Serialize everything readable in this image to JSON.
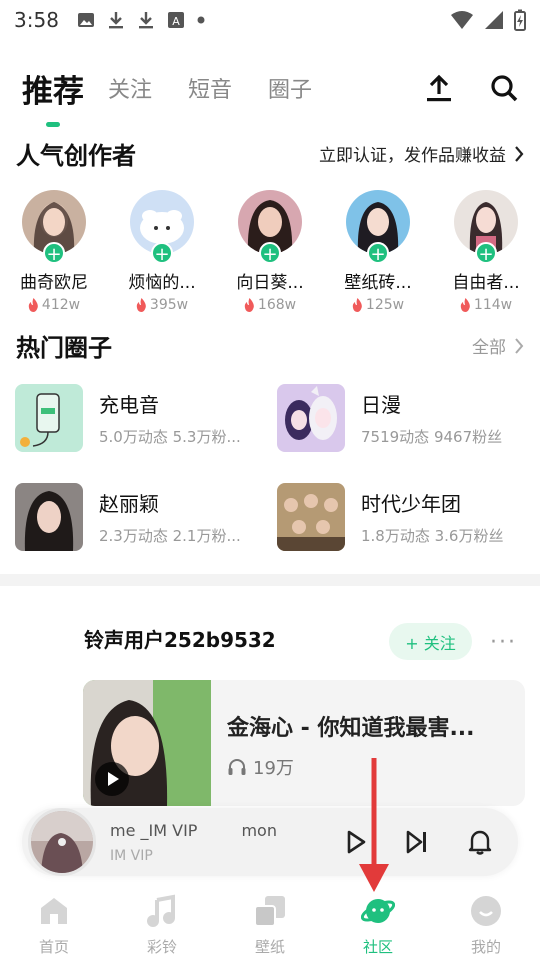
{
  "status_bar": {
    "time": "3:58"
  },
  "top_tabs": [
    {
      "label": "推荐",
      "active": true
    },
    {
      "label": "关注",
      "active": false
    },
    {
      "label": "短音",
      "active": false
    },
    {
      "label": "圈子",
      "active": false
    }
  ],
  "top_actions": {
    "upload_icon": "upload-icon",
    "search_icon": "search-icon"
  },
  "creators_section": {
    "title": "人气创作者",
    "link": "立即认证，发作品赚收益",
    "items": [
      {
        "name": "曲奇欧尼",
        "hot": "412w"
      },
      {
        "name": "烦恼的...",
        "hot": "395w"
      },
      {
        "name": "向日葵...",
        "hot": "168w"
      },
      {
        "name": "壁纸砖...",
        "hot": "125w"
      },
      {
        "name": "自由者...",
        "hot": "114w"
      }
    ]
  },
  "circles_section": {
    "title": "热门圈子",
    "link": "全部",
    "items": [
      {
        "name": "充电音",
        "stats": "5.0万动态   5.3万粉..."
      },
      {
        "name": "日漫",
        "stats": "7519动态   9467粉丝"
      },
      {
        "name": "赵丽颖",
        "stats": "2.3万动态   2.1万粉..."
      },
      {
        "name": "时代少年团",
        "stats": "1.8万动态   3.6万粉丝"
      }
    ]
  },
  "post": {
    "user": "铃声用户252b9532",
    "follow_label": "+ 关注",
    "more_label": "···",
    "title": "金海心 - 你知道我最害...",
    "plays": "19万"
  },
  "player": {
    "title_a": "me _IM VIP",
    "title_b": "mon",
    "subtitle": "IM VIP"
  },
  "bottom_nav": [
    {
      "label": "首页",
      "icon": "home-icon",
      "active": false
    },
    {
      "label": "彩铃",
      "icon": "music-note-icon",
      "active": false
    },
    {
      "label": "壁纸",
      "icon": "wallpaper-icon",
      "active": false
    },
    {
      "label": "社区",
      "icon": "planet-icon",
      "active": true
    },
    {
      "label": "我的",
      "icon": "profile-icon",
      "active": false
    }
  ],
  "colors": {
    "accent": "#1fc07f",
    "annotation": "#e23a3a",
    "hot": "#f05a5a"
  }
}
